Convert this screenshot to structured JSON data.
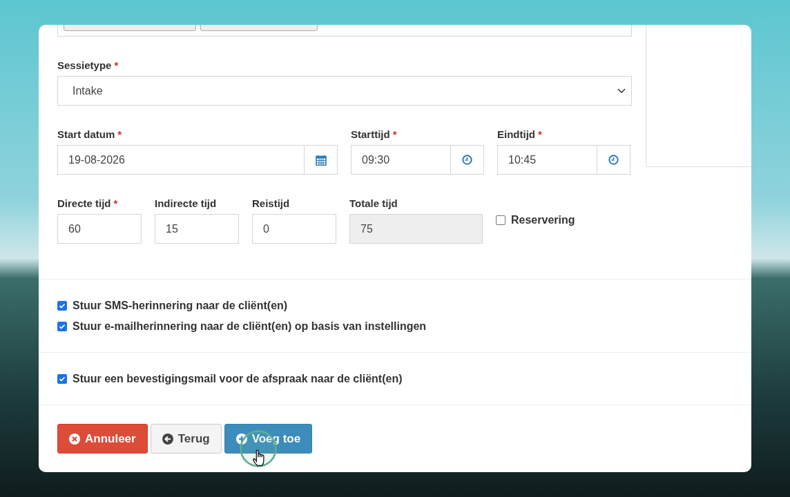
{
  "session_type": {
    "label": "Sessietype",
    "mark": "*",
    "value": "Intake"
  },
  "time_fields": [
    {
      "kind": "date",
      "label": "Start datum",
      "mark": "*",
      "value": "19-08-2026"
    },
    {
      "kind": "time",
      "label": "Starttijd",
      "mark": "*",
      "value": "09:30"
    },
    {
      "kind": "time",
      "label": "Eindtijd",
      "mark": "*",
      "value": "10:45"
    }
  ],
  "duration_fields": [
    {
      "label": "Directe tijd",
      "mark": "*",
      "value": "60",
      "disabled": false
    },
    {
      "label": "Indirecte tijd",
      "value": "15",
      "disabled": false
    },
    {
      "label": "Reistijd",
      "value": "0",
      "disabled": false
    },
    {
      "label": "Totale tijd",
      "value": "75",
      "disabled": true
    }
  ],
  "reservation": {
    "label": "Reservering",
    "checked": false
  },
  "reminders": [
    {
      "label": "Stuur SMS-herinnering naar de cliënt(en)",
      "checked": true
    },
    {
      "label": "Stuur e-mailherinnering naar de cliënt(en) op basis van instellingen",
      "checked": true
    }
  ],
  "confirmation": [
    {
      "label": "Stuur een bevestigingsmail voor de afspraak naar de cliënt(en)",
      "checked": true
    }
  ],
  "buttons": [
    {
      "kind": "danger",
      "label": "Annuleer"
    },
    {
      "kind": "default",
      "label": "Terug"
    },
    {
      "kind": "primary",
      "label": "Voeg toe"
    }
  ]
}
